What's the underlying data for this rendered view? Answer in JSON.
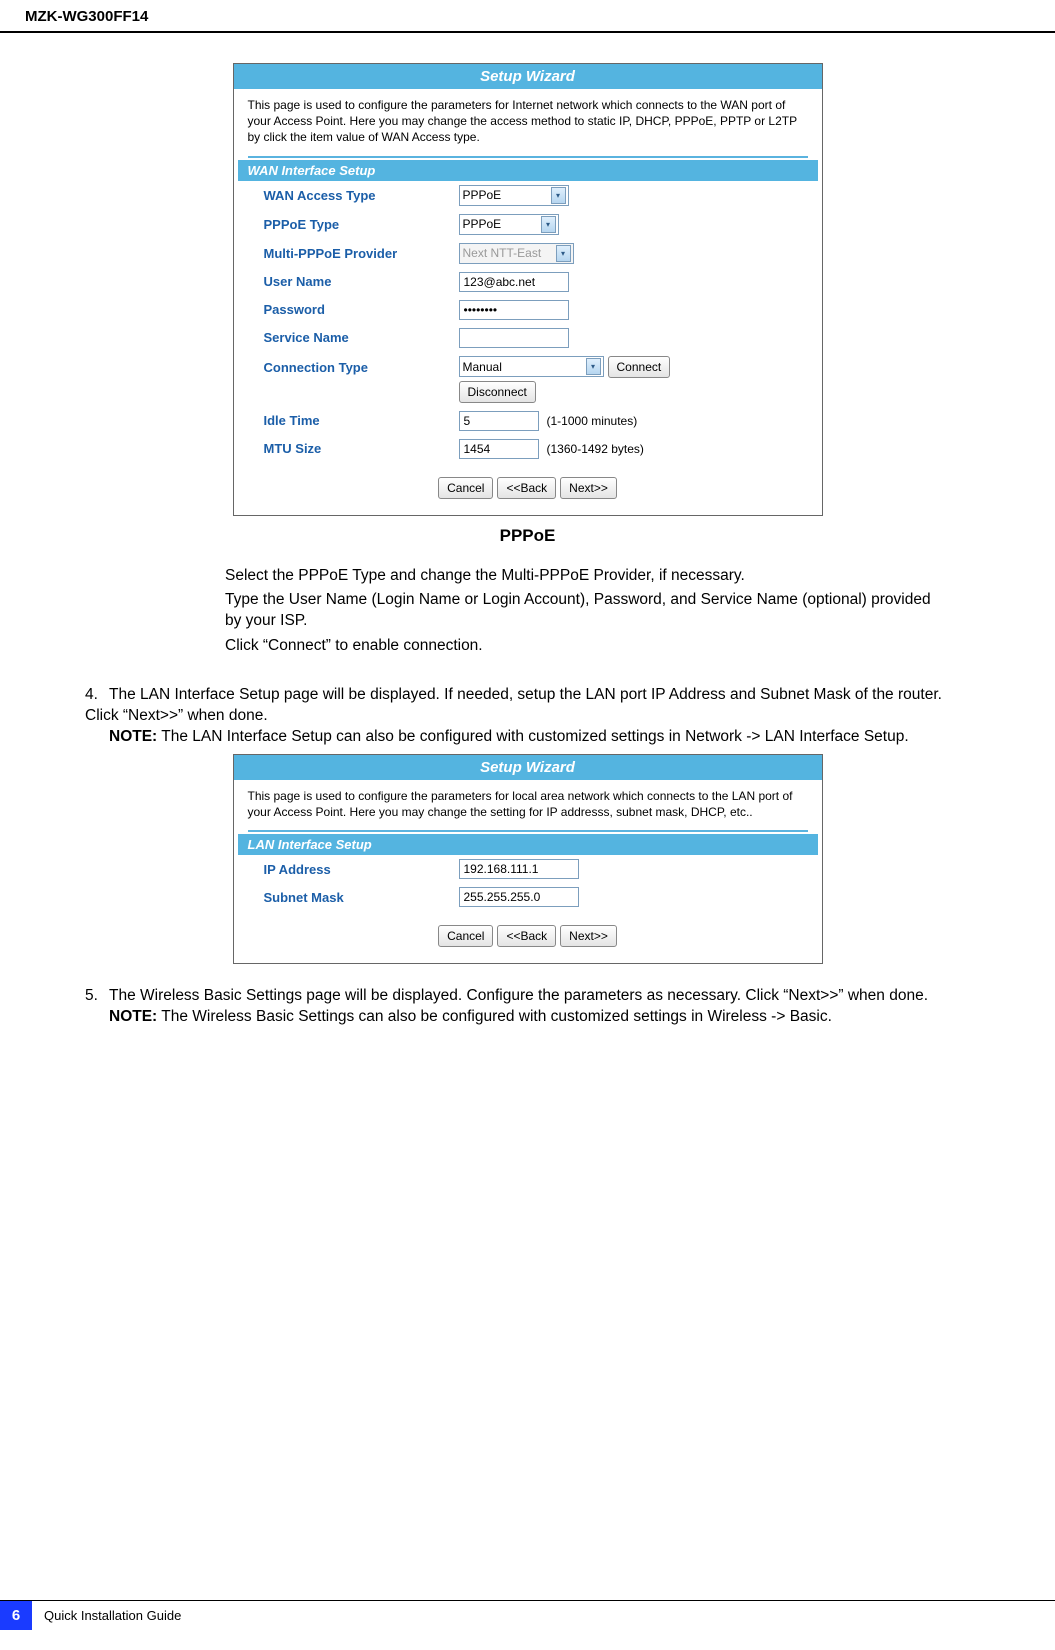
{
  "header": {
    "model": "MZK-WG300FF14"
  },
  "screenshot1": {
    "title": "Setup Wizard",
    "desc": "This page is used to configure the parameters for Internet network which connects to the WAN port of your Access Point. Here you may change the access method to static IP, DHCP, PPPoE, PPTP or L2TP by click the item value of WAN Access type.",
    "section": "WAN Interface Setup",
    "rows": {
      "wan_access_type": {
        "label": "WAN Access Type",
        "value": "PPPoE"
      },
      "pppoe_type": {
        "label": "PPPoE Type",
        "value": "PPPoE"
      },
      "multi_provider": {
        "label": "Multi-PPPoE Provider",
        "value": "Next NTT-East"
      },
      "user_name": {
        "label": "User Name",
        "value": "123@abc.net"
      },
      "password": {
        "label": "Password",
        "value": "••••••••"
      },
      "service_name": {
        "label": "Service Name",
        "value": ""
      },
      "connection_type": {
        "label": "Connection Type",
        "value": "Manual",
        "connect_btn": "Connect",
        "disconnect_btn": "Disconnect"
      },
      "idle_time": {
        "label": "Idle Time",
        "value": "5",
        "hint": "(1-1000 minutes)"
      },
      "mtu_size": {
        "label": "MTU Size",
        "value": "1454",
        "hint": "(1360-1492 bytes)"
      }
    },
    "buttons": {
      "cancel": "Cancel",
      "back": "<<Back",
      "next": "Next>>"
    },
    "caption": "PPPoE"
  },
  "instructions_block": {
    "p1": "Select the PPPoE Type and change the Multi-PPPoE Provider, if necessary.",
    "p2": "Type the User Name (Login Name or Login Account), Password, and Service Name (optional) provided by your ISP.",
    "p3": "Click “Connect” to enable connection."
  },
  "step4": {
    "text": "The LAN Interface Setup page will be displayed. If needed, setup the LAN port IP Address and Subnet Mask of the router. Click “Next>>” when done.",
    "note_label": "NOTE:",
    "note_text": " The LAN Interface Setup can also be configured with customized settings in Network -> LAN Interface Setup."
  },
  "screenshot2": {
    "title": "Setup Wizard",
    "desc": "This page is used to configure the parameters for local area network which connects to the LAN port of your Access Point. Here you may change the setting for IP addresss, subnet mask, DHCP, etc..",
    "section": "LAN Interface Setup",
    "rows": {
      "ip_address": {
        "label": "IP Address",
        "value": "192.168.111.1"
      },
      "subnet_mask": {
        "label": "Subnet Mask",
        "value": "255.255.255.0"
      }
    },
    "buttons": {
      "cancel": "Cancel",
      "back": "<<Back",
      "next": "Next>>"
    }
  },
  "step5": {
    "text": "The Wireless Basic Settings page will be displayed. Configure the parameters as necessary. Click “Next>>” when done.",
    "note_label": "NOTE:",
    "note_text": "  The Wireless Basic Settings can also be configured with customized settings in Wireless -> Basic."
  },
  "footer": {
    "page": "6",
    "title": "Quick Installation Guide"
  }
}
